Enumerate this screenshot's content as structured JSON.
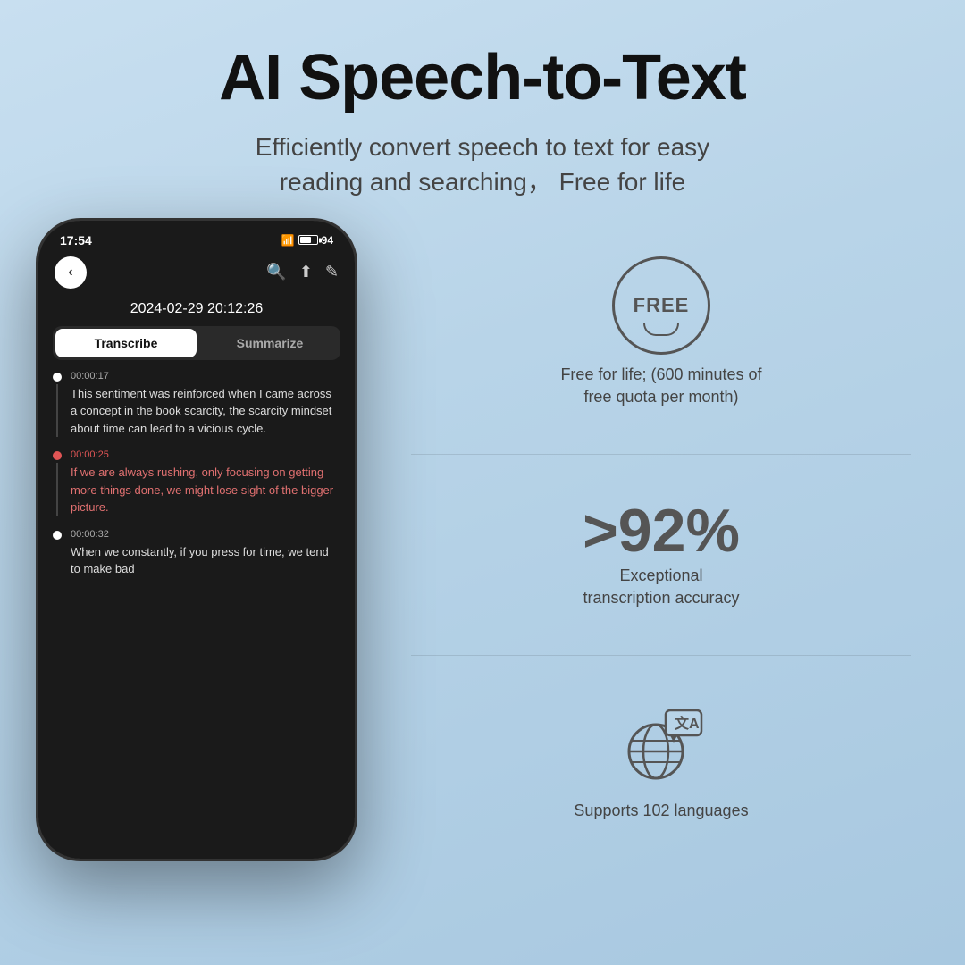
{
  "page": {
    "background": "#b8d4e8"
  },
  "header": {
    "title": "AI Speech-to-Text",
    "subtitle_line1": "Efficiently convert speech to text for easy",
    "subtitle_line2": "reading and searching，  Free for life"
  },
  "phone": {
    "status_bar": {
      "time": "17:54",
      "battery": "94"
    },
    "timestamp": "2024-02-29 20:12:26",
    "tabs": {
      "active": "Transcribe",
      "inactive": "Summarize"
    },
    "transcripts": [
      {
        "time": "00:00:17",
        "text": "This sentiment was reinforced when I came across a concept in the book scarcity, the scarcity mindset about time can lead to a vicious cycle.",
        "highlight": false
      },
      {
        "time": "00:00:25",
        "text": "If we are always rushing, only focusing on getting more things done, we might lose sight of the bigger picture.",
        "highlight": true
      },
      {
        "time": "00:00:32",
        "text": "When we constantly, if you press for time, we tend to make bad",
        "highlight": false
      }
    ]
  },
  "features": [
    {
      "id": "free",
      "badge_text": "FREE",
      "description": "Free for life; (600 minutes of\nfree quota per month)"
    },
    {
      "id": "accuracy",
      "number": ">92%",
      "description": "Exceptional\ntranscription accuracy"
    },
    {
      "id": "languages",
      "count": "102",
      "description": "Supports  102 languages"
    }
  ]
}
